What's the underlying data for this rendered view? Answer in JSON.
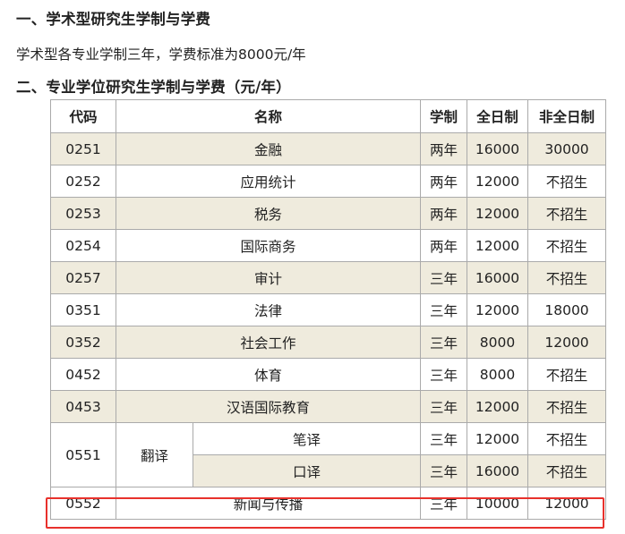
{
  "section1": {
    "heading": "一、学术型研究生学制与学费",
    "text": "学术型各专业学制三年，学费标准为8000元/年"
  },
  "section2": {
    "heading": "二、专业学位研究生学制与学费（元/年）"
  },
  "table": {
    "headers": [
      "代码",
      "名称",
      "学制",
      "全日制",
      "非全日制"
    ],
    "rows": [
      {
        "code": "0251",
        "name": "金融",
        "duration": "两年",
        "fulltime": "16000",
        "parttime": "30000"
      },
      {
        "code": "0252",
        "name": "应用统计",
        "duration": "两年",
        "fulltime": "12000",
        "parttime": "不招生"
      },
      {
        "code": "0253",
        "name": "税务",
        "duration": "两年",
        "fulltime": "12000",
        "parttime": "不招生"
      },
      {
        "code": "0254",
        "name": "国际商务",
        "duration": "两年",
        "fulltime": "12000",
        "parttime": "不招生"
      },
      {
        "code": "0257",
        "name": "审计",
        "duration": "三年",
        "fulltime": "16000",
        "parttime": "不招生"
      },
      {
        "code": "0351",
        "name": "法律",
        "duration": "三年",
        "fulltime": "12000",
        "parttime": "18000"
      },
      {
        "code": "0352",
        "name": "社会工作",
        "duration": "三年",
        "fulltime": "8000",
        "parttime": "12000"
      },
      {
        "code": "0452",
        "name": "体育",
        "duration": "三年",
        "fulltime": "8000",
        "parttime": "不招生"
      },
      {
        "code": "0453",
        "name": "汉语国际教育",
        "duration": "三年",
        "fulltime": "12000",
        "parttime": "不招生"
      }
    ],
    "translation": {
      "code": "0551",
      "name": "翻译",
      "subs": [
        {
          "name": "笔译",
          "duration": "三年",
          "fulltime": "12000",
          "parttime": "不招生"
        },
        {
          "name": "口译",
          "duration": "三年",
          "fulltime": "16000",
          "parttime": "不招生"
        }
      ]
    },
    "last_row": {
      "code": "0552",
      "name": "新闻与传播",
      "duration": "三年",
      "fulltime": "10000",
      "parttime": "12000"
    }
  },
  "colors": {
    "stripe": "#efebdd",
    "highlight": "#e8312c",
    "border": "#aaaaaa"
  }
}
